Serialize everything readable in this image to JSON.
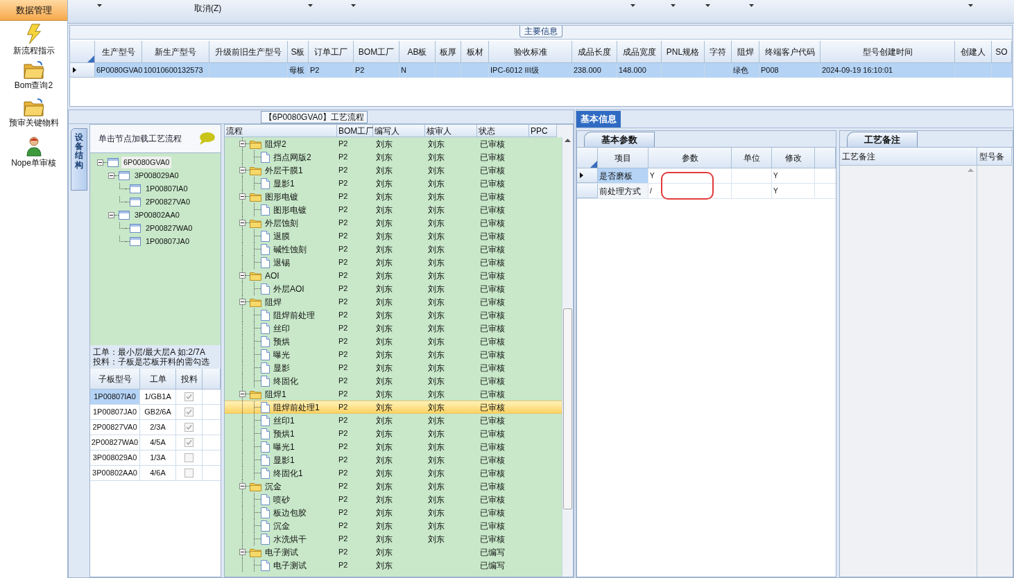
{
  "sidebar": {
    "header": "数据管理",
    "items": [
      {
        "kind": "lightning",
        "label": "新流程指示"
      },
      {
        "kind": "folder",
        "label": "Bom查询2"
      },
      {
        "kind": "folder",
        "label": "预审关键物料"
      },
      {
        "kind": "person",
        "label": "Nope单审核"
      }
    ]
  },
  "toolbar": {
    "cancel_label": "取消(Z)"
  },
  "main_info": {
    "title": "主要信息",
    "columns": [
      "生产型号",
      "新生产型号",
      "升级前旧生产型号",
      "S板",
      "订单工厂",
      "BOM工厂",
      "AB板",
      "板厚",
      "板材",
      "验收标准",
      "成品长度",
      "成品宽度",
      "PNL规格",
      "字符",
      "阻焊",
      "终端客户代码",
      "型号创建时间",
      "创建人",
      "SO"
    ],
    "rows": [
      {
        "selected": true,
        "cells": [
          "6P0080GVA0",
          "10010600132573",
          "",
          "母板",
          "P2",
          "P2",
          "N",
          "",
          "",
          "IPC-6012 III级",
          "238.000",
          "148.000",
          "",
          "",
          "绿色",
          "P008",
          "2024-09-19 16:10:01",
          "",
          ""
        ]
      }
    ]
  },
  "process_panel": {
    "title": "【6P0080GVA0】工艺流程",
    "side_tab": "设备结构",
    "hint": "单击节点加载工艺流程",
    "structure_tree": [
      {
        "label": "6P0080GVA0",
        "selected": true,
        "expanded": true,
        "children": [
          {
            "label": "3P008029A0",
            "selected": false,
            "expanded": true,
            "children": [
              {
                "label": "1P00807IA0",
                "selected": false
              },
              {
                "label": "2P00827VA0",
                "selected": false
              }
            ]
          },
          {
            "label": "3P00802AA0",
            "selected": false,
            "expanded": true,
            "children": [
              {
                "label": "2P00827WA0",
                "selected": false
              },
              {
                "label": "1P00807JA0",
                "selected": false
              }
            ]
          }
        ]
      }
    ],
    "notes": [
      "工单：最小层/最大层A 如:2/7A",
      "投料：子板是芯板开料的需勾选"
    ],
    "subboards": {
      "columns": [
        "子板型号",
        "工单",
        "投料"
      ],
      "rows": [
        {
          "model": "1P00807IA0",
          "order": "1/GB1A",
          "checked": true,
          "selected": true
        },
        {
          "model": "1P00807JA0",
          "order": "GB2/6A",
          "checked": true,
          "selected": false
        },
        {
          "model": "2P00827VA0",
          "order": "2/3A",
          "checked": true,
          "selected": false
        },
        {
          "model": "2P00827WA0",
          "order": "4/5A",
          "checked": true,
          "selected": false
        },
        {
          "model": "3P008029A0",
          "order": "1/3A",
          "checked": false,
          "selected": false
        },
        {
          "model": "3P00802AA0",
          "order": "4/6A",
          "checked": false,
          "selected": false
        }
      ]
    }
  },
  "flow": {
    "columns": [
      "流程",
      "BOM工厂",
      "编写人",
      "核审人",
      "状态",
      "PPC"
    ],
    "rows": [
      {
        "name": "阻焊2",
        "bom": "P2",
        "writer": "刘东",
        "reviewer": "刘东",
        "status": "已审核",
        "expanded": true,
        "selected": false,
        "children": [
          {
            "name": "挡点网版2",
            "bom": "P2",
            "writer": "刘东",
            "reviewer": "刘东",
            "status": "已审核",
            "selected": false
          }
        ]
      },
      {
        "name": "外层干膜1",
        "bom": "P2",
        "writer": "刘东",
        "reviewer": "刘东",
        "status": "已审核",
        "expanded": true,
        "selected": false,
        "children": [
          {
            "name": "显影1",
            "bom": "P2",
            "writer": "刘东",
            "reviewer": "刘东",
            "status": "已审核",
            "selected": false
          }
        ]
      },
      {
        "name": "图形电镀",
        "bom": "P2",
        "writer": "刘东",
        "reviewer": "刘东",
        "status": "已审核",
        "expanded": true,
        "selected": false,
        "children": [
          {
            "name": "图形电镀",
            "bom": "P2",
            "writer": "刘东",
            "reviewer": "刘东",
            "status": "已审核",
            "selected": false
          }
        ]
      },
      {
        "name": "外层蚀刻",
        "bom": "P2",
        "writer": "刘东",
        "reviewer": "刘东",
        "status": "已审核",
        "expanded": true,
        "selected": false,
        "children": [
          {
            "name": "退膜",
            "bom": "P2",
            "writer": "刘东",
            "reviewer": "刘东",
            "status": "已审核",
            "selected": false
          },
          {
            "name": "碱性蚀刻",
            "bom": "P2",
            "writer": "刘东",
            "reviewer": "刘东",
            "status": "已审核",
            "selected": false
          },
          {
            "name": "退锡",
            "bom": "P2",
            "writer": "刘东",
            "reviewer": "刘东",
            "status": "已审核",
            "selected": false
          }
        ]
      },
      {
        "name": "AOI",
        "bom": "P2",
        "writer": "刘东",
        "reviewer": "刘东",
        "status": "已审核",
        "expanded": true,
        "selected": false,
        "children": [
          {
            "name": "外层AOI",
            "bom": "P2",
            "writer": "刘东",
            "reviewer": "刘东",
            "status": "已审核",
            "selected": false
          }
        ]
      },
      {
        "name": "阻焊",
        "bom": "P2",
        "writer": "刘东",
        "reviewer": "刘东",
        "status": "已审核",
        "expanded": true,
        "selected": false,
        "children": [
          {
            "name": "阻焊前处理",
            "bom": "P2",
            "writer": "刘东",
            "reviewer": "刘东",
            "status": "已审核",
            "selected": false
          },
          {
            "name": "丝印",
            "bom": "P2",
            "writer": "刘东",
            "reviewer": "刘东",
            "status": "已审核",
            "selected": false
          },
          {
            "name": "预烘",
            "bom": "P2",
            "writer": "刘东",
            "reviewer": "刘东",
            "status": "已审核",
            "selected": false
          },
          {
            "name": "曝光",
            "bom": "P2",
            "writer": "刘东",
            "reviewer": "刘东",
            "status": "已审核",
            "selected": false
          },
          {
            "name": "显影",
            "bom": "P2",
            "writer": "刘东",
            "reviewer": "刘东",
            "status": "已审核",
            "selected": false
          },
          {
            "name": "终固化",
            "bom": "P2",
            "writer": "刘东",
            "reviewer": "刘东",
            "status": "已审核",
            "selected": false
          }
        ]
      },
      {
        "name": "阻焊1",
        "bom": "P2",
        "writer": "刘东",
        "reviewer": "刘东",
        "status": "已审核",
        "expanded": true,
        "selected": false,
        "children": [
          {
            "name": "阻焊前处理1",
            "bom": "P2",
            "writer": "刘东",
            "reviewer": "刘东",
            "status": "已审核",
            "selected": true
          },
          {
            "name": "丝印1",
            "bom": "P2",
            "writer": "刘东",
            "reviewer": "刘东",
            "status": "已审核",
            "selected": false
          },
          {
            "name": "预烘1",
            "bom": "P2",
            "writer": "刘东",
            "reviewer": "刘东",
            "status": "已审核",
            "selected": false
          },
          {
            "name": "曝光1",
            "bom": "P2",
            "writer": "刘东",
            "reviewer": "刘东",
            "status": "已审核",
            "selected": false
          },
          {
            "name": "显影1",
            "bom": "P2",
            "writer": "刘东",
            "reviewer": "刘东",
            "status": "已审核",
            "selected": false
          },
          {
            "name": "终固化1",
            "bom": "P2",
            "writer": "刘东",
            "reviewer": "刘东",
            "status": "已审核",
            "selected": false
          }
        ]
      },
      {
        "name": "沉金",
        "bom": "P2",
        "writer": "刘东",
        "reviewer": "刘东",
        "status": "已审核",
        "expanded": true,
        "selected": false,
        "children": [
          {
            "name": "喷砂",
            "bom": "P2",
            "writer": "刘东",
            "reviewer": "刘东",
            "status": "已审核",
            "selected": false
          },
          {
            "name": "板边包胶",
            "bom": "P2",
            "writer": "刘东",
            "reviewer": "刘东",
            "status": "已审核",
            "selected": false
          },
          {
            "name": "沉金",
            "bom": "P2",
            "writer": "刘东",
            "reviewer": "刘东",
            "status": "已审核",
            "selected": false
          },
          {
            "name": "水洗烘干",
            "bom": "P2",
            "writer": "刘东",
            "reviewer": "刘东",
            "status": "已审核",
            "selected": false
          }
        ]
      },
      {
        "name": "电子测试",
        "bom": "P2",
        "writer": "刘东",
        "status": "已编写",
        "expanded": true,
        "selected": false,
        "children": [
          {
            "name": "电子测试",
            "bom": "P2",
            "writer": "刘东",
            "status": "已编写",
            "selected": false
          }
        ]
      }
    ]
  },
  "info_tab": {
    "label": "基本信息",
    "selected": true
  },
  "params": {
    "tab": "基本参数",
    "columns": [
      "项目",
      "参数",
      "单位",
      "修改"
    ],
    "rows": [
      {
        "selected": true,
        "cells": [
          "是否磨板",
          "Y",
          "",
          "Y"
        ]
      },
      {
        "selected": false,
        "cells": [
          "前处理方式",
          "/",
          "",
          "Y"
        ]
      }
    ]
  },
  "remarks": {
    "tab": "工艺备注",
    "columns": [
      "工艺备注",
      "型号备"
    ]
  }
}
